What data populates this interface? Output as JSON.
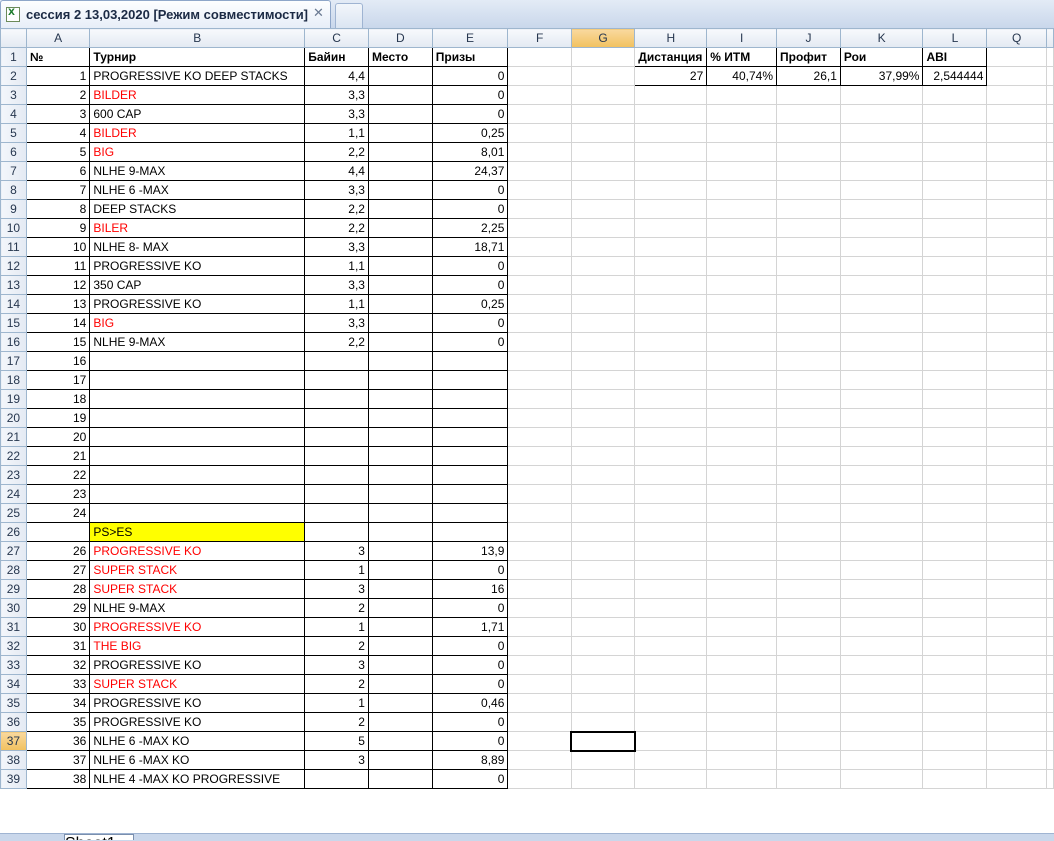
{
  "window": {
    "title": "сессия 2 13,03,2020  [Режим совместимости]",
    "close_glyph": "✕",
    "file_icon": "excel-file-icon"
  },
  "columns": [
    "A",
    "B",
    "C",
    "D",
    "E",
    "F",
    "G",
    "H",
    "I",
    "J",
    "K",
    "L",
    "Q"
  ],
  "selected_column": "G",
  "selected_row": 37,
  "header_row": {
    "a": "№",
    "b": "Турнир",
    "c": "Байин",
    "d": "Место",
    "e": "Призы",
    "h": "Дистанция",
    "i": "% ИТМ",
    "j": "Профит",
    "k": "Рои",
    "l": "ABI"
  },
  "stats_row": {
    "h": "27",
    "i": "40,74%",
    "j": "26,1",
    "k": "37,99%",
    "l": "2,544444"
  },
  "rows": [
    {
      "r": "2",
      "a": "1",
      "b": "PROGRESSIVE KO DEEP STACKS",
      "c": "4,4",
      "e": "0",
      "red": false
    },
    {
      "r": "3",
      "a": "2",
      "b": "BILDER",
      "c": "3,3",
      "e": "0",
      "red": true
    },
    {
      "r": "4",
      "a": "3",
      "b": "600 CAP",
      "c": "3,3",
      "e": "0",
      "red": false
    },
    {
      "r": "5",
      "a": "4",
      "b": "BILDER",
      "c": "1,1",
      "e": "0,25",
      "red": true
    },
    {
      "r": "6",
      "a": "5",
      "b": "BIG",
      "c": "2,2",
      "e": "8,01",
      "red": true
    },
    {
      "r": "7",
      "a": "6",
      "b": "NLHE 9-MAX",
      "c": "4,4",
      "e": "24,37",
      "red": false
    },
    {
      "r": "8",
      "a": "7",
      "b": "NLHE 6 -MAX",
      "c": "3,3",
      "e": "0",
      "red": false
    },
    {
      "r": "9",
      "a": "8",
      "b": "DEEP STACKS",
      "c": "2,2",
      "e": "0",
      "red": false
    },
    {
      "r": "10",
      "a": "9",
      "b": "BILER",
      "c": "2,2",
      "e": "2,25",
      "red": true
    },
    {
      "r": "11",
      "a": "10",
      "b": "NLHE 8- MAX",
      "c": "3,3",
      "e": "18,71",
      "red": false
    },
    {
      "r": "12",
      "a": "11",
      "b": "PROGRESSIVE KO",
      "c": "1,1",
      "e": "0",
      "red": false
    },
    {
      "r": "13",
      "a": "12",
      "b": "350 CAP",
      "c": "3,3",
      "e": "0",
      "red": false
    },
    {
      "r": "14",
      "a": "13",
      "b": "PROGRESSIVE KO",
      "c": "1,1",
      "e": "0,25",
      "red": false
    },
    {
      "r": "15",
      "a": "14",
      "b": "BIG",
      "c": "3,3",
      "e": "0",
      "red": true
    },
    {
      "r": "16",
      "a": "15",
      "b": "NLHE 9-MAX",
      "c": "2,2",
      "e": "0",
      "red": false
    },
    {
      "r": "17",
      "a": "16",
      "b": "",
      "c": "",
      "e": "",
      "red": false
    },
    {
      "r": "18",
      "a": "17",
      "b": "",
      "c": "",
      "e": "",
      "red": false
    },
    {
      "r": "19",
      "a": "18",
      "b": "",
      "c": "",
      "e": "",
      "red": false
    },
    {
      "r": "20",
      "a": "19",
      "b": "",
      "c": "",
      "e": "",
      "red": false
    },
    {
      "r": "21",
      "a": "20",
      "b": "",
      "c": "",
      "e": "",
      "red": false
    },
    {
      "r": "22",
      "a": "21",
      "b": "",
      "c": "",
      "e": "",
      "red": false
    },
    {
      "r": "23",
      "a": "22",
      "b": "",
      "c": "",
      "e": "",
      "red": false
    },
    {
      "r": "24",
      "a": "23",
      "b": "",
      "c": "",
      "e": "",
      "red": false
    },
    {
      "r": "25",
      "a": "24",
      "b": "",
      "c": "",
      "e": "",
      "red": false
    },
    {
      "r": "26",
      "a": "",
      "b": "PS>ES",
      "c": "",
      "e": "",
      "red": false,
      "yellow": true
    },
    {
      "r": "27",
      "a": "26",
      "b": "PROGRESSIVE KO",
      "c": "3",
      "e": "13,9",
      "red": true
    },
    {
      "r": "28",
      "a": "27",
      "b": "SUPER STACK",
      "c": "1",
      "e": "0",
      "red": true
    },
    {
      "r": "29",
      "a": "28",
      "b": "SUPER STACK",
      "c": "3",
      "e": "16",
      "red": true
    },
    {
      "r": "30",
      "a": "29",
      "b": "NLHE 9-MAX",
      "c": "2",
      "e": "0",
      "red": false
    },
    {
      "r": "31",
      "a": "30",
      "b": "PROGRESSIVE KO",
      "c": "1",
      "e": "1,71",
      "red": true
    },
    {
      "r": "32",
      "a": "31",
      "b": "THE BIG",
      "c": "2",
      "e": "0",
      "red": true
    },
    {
      "r": "33",
      "a": "32",
      "b": "PROGRESSIVE KO",
      "c": "3",
      "e": "0",
      "red": false
    },
    {
      "r": "34",
      "a": "33",
      "b": "SUPER STACK",
      "c": "2",
      "e": "0",
      "red": true
    },
    {
      "r": "35",
      "a": "34",
      "b": "PROGRESSIVE KO",
      "c": "1",
      "e": "0,46",
      "red": false
    },
    {
      "r": "36",
      "a": "35",
      "b": "PROGRESSIVE KO",
      "c": "2",
      "e": "0",
      "red": false
    },
    {
      "r": "37",
      "a": "36",
      "b": "NLHE 6 -MAX KO",
      "c": "5",
      "e": "0",
      "red": false
    },
    {
      "r": "38",
      "a": "37",
      "b": "NLHE 6 -MAX KO",
      "c": "3",
      "e": "8,89",
      "red": false
    },
    {
      "r": "39",
      "a": "38",
      "b": "NLHE 4 -MAX KO PROGRESSIVE",
      "c": "",
      "e": "0",
      "red": false
    }
  ],
  "sheet_tab": "Sheet1"
}
